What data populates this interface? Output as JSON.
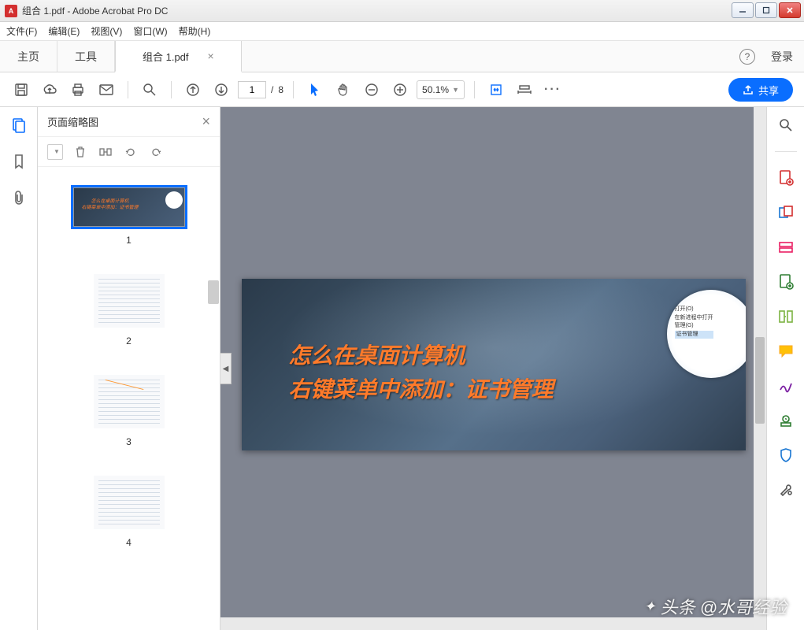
{
  "window": {
    "title": "组合 1.pdf - Adobe Acrobat Pro DC",
    "app_badge": "A"
  },
  "menu": {
    "file": "文件(F)",
    "edit": "编辑(E)",
    "view": "视图(V)",
    "window": "窗口(W)",
    "help": "帮助(H)"
  },
  "tabs": {
    "home": "主页",
    "tools": "工具",
    "document": "组合 1.pdf",
    "login": "登录"
  },
  "toolbar": {
    "page_current": "1",
    "page_sep": "/",
    "page_total": "8",
    "zoom_value": "50.1%",
    "share_label": "共享"
  },
  "thumbnails": {
    "panel_title": "页面缩略图",
    "items": [
      {
        "num": "1"
      },
      {
        "num": "2"
      },
      {
        "num": "3"
      },
      {
        "num": "4"
      }
    ]
  },
  "document": {
    "line1": "怎么在桌面计算机",
    "line2": "右键菜单中添加：证书管理",
    "inset": {
      "l1": "打开(O)",
      "l2": "在新进程中打开",
      "l3": "管理(G)",
      "l4": "证书管理"
    }
  },
  "watermark": {
    "prefix": "头条",
    "author": "@水哥经验"
  }
}
